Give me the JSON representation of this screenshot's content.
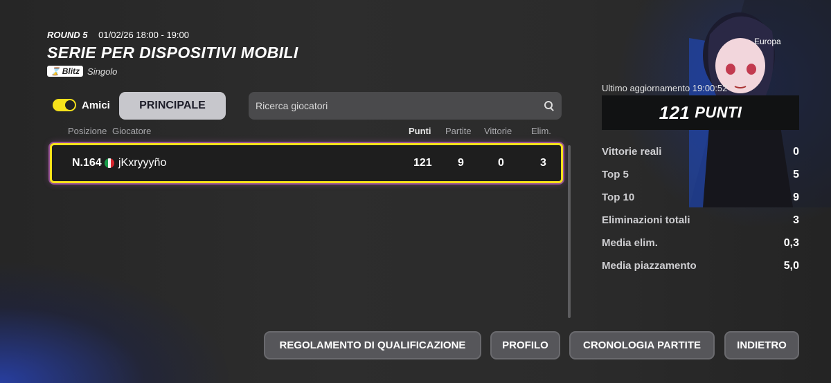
{
  "header": {
    "round": "ROUND 5",
    "datetime": "01/02/26 18:00 - 19:00",
    "title": "SERIE PER DISPOSITIVI MOBILI",
    "mode_badge": "Blitz",
    "mode_type": "Singolo"
  },
  "filters": {
    "friends_label": "Amici",
    "friends_enabled": true,
    "tab_label": "PRINCIPALE",
    "search_placeholder": "Ricerca giocatori"
  },
  "table": {
    "headers": {
      "position": "Posizione",
      "player": "Giocatore",
      "points": "Punti",
      "matches": "Partite",
      "wins": "Vittorie",
      "elims": "Elim."
    },
    "rows": [
      {
        "rank": "N.164",
        "country": "italy-flag",
        "player": "jKxryyyño",
        "points": "121",
        "matches": "9",
        "wins": "0",
        "elims": "3"
      }
    ]
  },
  "profile": {
    "region": "Europa",
    "last_update": "Ultimo aggiornamento 19:00:52",
    "points_value": "121",
    "points_unit": "PUNTI",
    "stats": [
      {
        "label": "Vittorie reali",
        "value": "0"
      },
      {
        "label": "Top 5",
        "value": "5"
      },
      {
        "label": "Top 10",
        "value": "9"
      },
      {
        "label": "Eliminazioni totali",
        "value": "3"
      },
      {
        "label": "Media elim.",
        "value": "0,3"
      },
      {
        "label": "Media piazzamento",
        "value": "5,0"
      }
    ]
  },
  "buttons": {
    "rules": "REGOLAMENTO DI QUALIFICAZIONE",
    "profile": "PROFILO",
    "history": "CRONOLOGIA PARTITE",
    "back": "INDIETRO"
  },
  "colors": {
    "accent_yellow": "#f5e11b",
    "selection_glow": "#e678dc",
    "panel_dark": "#111213"
  }
}
